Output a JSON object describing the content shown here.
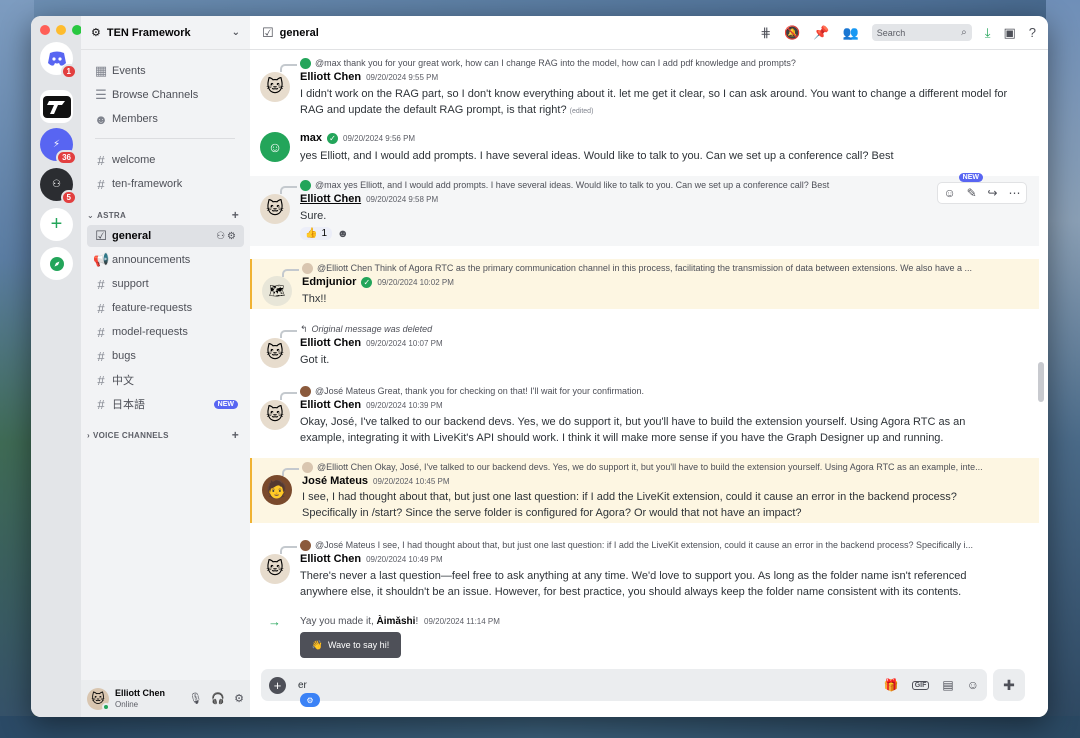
{
  "server": {
    "name": "TEN Framework"
  },
  "rail": {
    "discord_badge": "1",
    "server3_badge": "36",
    "server4_badge": "5"
  },
  "sidebar": {
    "top_items": [
      {
        "label": "Events",
        "icon": "calendar-icon"
      },
      {
        "label": "Browse Channels",
        "icon": "browse-icon"
      },
      {
        "label": "Members",
        "icon": "members-icon"
      }
    ],
    "channels": [
      {
        "label": "welcome"
      },
      {
        "label": "ten-framework"
      }
    ],
    "category_astra": "ASTRA",
    "astra_channels": [
      {
        "label": "general"
      },
      {
        "label": "announcements"
      },
      {
        "label": "support"
      },
      {
        "label": "feature-requests"
      },
      {
        "label": "model-requests"
      },
      {
        "label": "bugs"
      },
      {
        "label": "中文"
      },
      {
        "label": "日本語",
        "badge": "NEW"
      }
    ],
    "category_voice": "VOICE CHANNELS"
  },
  "user": {
    "name": "Elliott Chen",
    "status": "Online"
  },
  "topbar": {
    "channel": "general",
    "search_placeholder": "Search"
  },
  "messages": [
    {
      "reply": "@max thank you for your great work, how can I change RAG into the model, how can I add pdf knowledge  and prompts?",
      "author": "Elliott Chen",
      "time": "09/20/2024 9:55 PM",
      "body": "I didn't work on the RAG part, so I don't know everything about it. let me get it clear, so I  can ask around. You want to change a different model for RAG and update the default RAG prompt, is that right?",
      "edited": "(edited)"
    },
    {
      "author": "max",
      "time": "09/20/2024 9:56 PM",
      "body": "yes Elliott, and I would add prompts. I have several ideas. Would like to talk to you. Can we set up a conference call? Best"
    },
    {
      "reply": "@max yes Elliott, and I would add prompts. I have several ideas. Would like to talk to you. Can we set up a conference call? Best",
      "author": "Elliott Chen",
      "time": "09/20/2024 9:58 PM",
      "body": "Sure.",
      "reaction_count": "1"
    },
    {
      "reply": "@Elliott Chen Think of Agora RTC as the primary communication channel in this process, facilitating the transmission of data between extensions. We also have a ...",
      "author": "Edmjunior",
      "time": "09/20/2024 10:02 PM",
      "body": "Thx!!"
    },
    {
      "reply": "Original message was deleted",
      "author": "Elliott Chen",
      "time": "09/20/2024 10:07 PM",
      "body": "Got it."
    },
    {
      "reply": "@José Mateus Great, thank you for checking on that! I'll wait for your confirmation.",
      "author": "Elliott Chen",
      "time": "09/20/2024 10:39 PM",
      "body": "Okay, José, I've talked to our backend devs. Yes, we do support it, but you'll have to build the extension yourself. Using Agora RTC as an example, integrating it with LiveKit's API should work. I think it will make more sense if you have the Graph Designer up and running."
    },
    {
      "reply": "@Elliott Chen Okay, José, I've talked to our backend devs. Yes, we do support it, but you'll have to build the extension yourself. Using Agora RTC as an example, inte...",
      "author": "José Mateus",
      "time": "09/20/2024 10:45 PM",
      "body": "I see, I had thought about that, but just one last question: if I add the LiveKit extension, could it cause an error in the backend process? Specifically in /start? Since the serve folder is configured for Agora? Or would that not have an impact?"
    },
    {
      "reply": "@José Mateus I see, I had thought about that, but just one last question: if I add the LiveKit extension, could it cause an error in the backend process? Specifically i...",
      "author": "Elliott Chen",
      "time": "09/20/2024 10:49 PM",
      "body": "There's never a last question—feel free to ask anything at any time. We'd love to support you. As long as the folder name isn't referenced anywhere else, it shouldn't be an issue. However, for best practice, you should always keep the folder name consistent with its contents."
    }
  ],
  "system": {
    "prefix": "Yay you made it,",
    "name": "Àimǎshi",
    "suffix": "!",
    "time": "09/20/2024 11:14 PM",
    "wave_label": "Wave to say hi!"
  },
  "hover_new": "NEW",
  "composer": {
    "value": "er"
  }
}
